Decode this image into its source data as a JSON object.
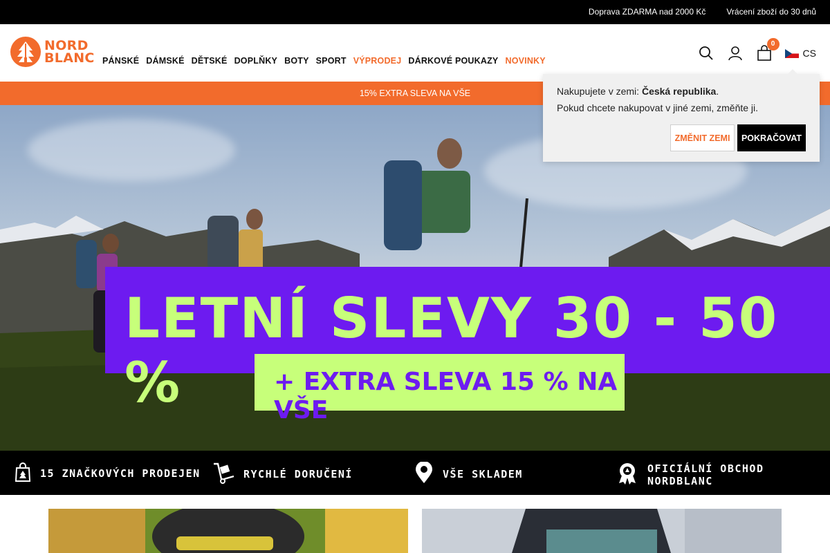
{
  "topbar": {
    "shipping": "Doprava ZDARMA nad 2000 Kč",
    "returns": "Vrácení zboží do 30 dnů"
  },
  "logo": {
    "line1": "NORD",
    "line2": "BLANC"
  },
  "nav": [
    {
      "label": "PÁNSKÉ"
    },
    {
      "label": "DÁMSKÉ"
    },
    {
      "label": "DĚTSKÉ"
    },
    {
      "label": "DOPLŇKY"
    },
    {
      "label": "BOTY"
    },
    {
      "label": "SPORT"
    },
    {
      "label": "VÝPRODEJ",
      "accent": true
    },
    {
      "label": "DÁRKOVÉ POUKAZY"
    },
    {
      "label": "NOVINKY",
      "accent": true
    }
  ],
  "header": {
    "cart_count": "0",
    "lang": "CS",
    "icons": [
      "search-icon",
      "user-icon",
      "cart-icon",
      "czech-flag-icon"
    ]
  },
  "promo": {
    "text": "15% EXTRA SLEVA NA VŠE"
  },
  "hero": {
    "headline": "LETNÍ SLEVY 30 - 50 %",
    "subline": "+ EXTRA SLEVA 15 % NA VŠE"
  },
  "features": [
    {
      "label": "15 ZNAČKOVÝCH PRODEJEN",
      "icon": "store-bag-icon"
    },
    {
      "label": "RYCHLÉ DORUČENÍ",
      "icon": "delivery-trolley-icon"
    },
    {
      "label": "VŠE SKLADEM",
      "icon": "location-pin-icon"
    },
    {
      "label": "OFICIÁLNÍ OBCHOD NORDBLANC",
      "icon": "award-badge-icon"
    }
  ],
  "popup": {
    "prefix": "Nakupujete v zemi: ",
    "country": "Česká republika",
    "suffix": ".",
    "line2": "Pokud chcete nakupovat v jiné zemi, změňte ji.",
    "change_button": "ZMĚNIT ZEMI",
    "continue_button": "POKRAČOVAT"
  },
  "colors": {
    "brand_orange": "#f26b2c",
    "banner_purple": "#6d1bf0",
    "banner_lime": "#c7ff7a"
  }
}
